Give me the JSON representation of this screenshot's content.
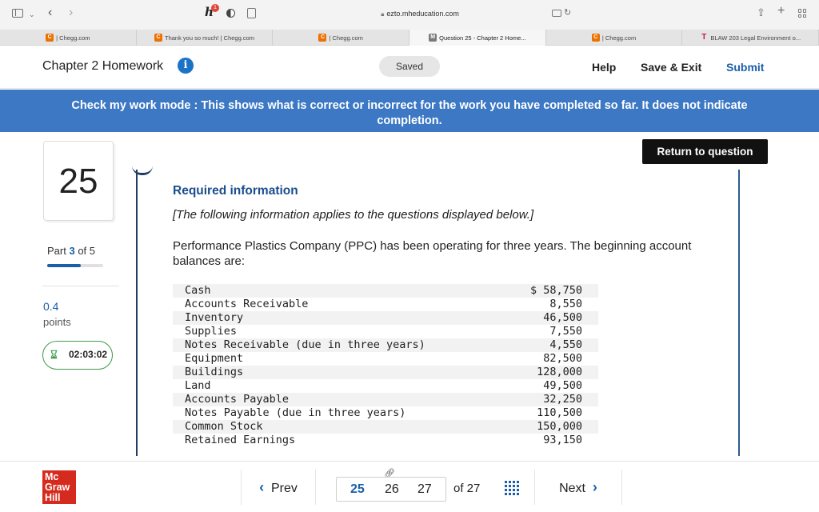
{
  "browser": {
    "url": "ezto.mheducation.com",
    "ext_badge": "1",
    "tabs": [
      {
        "label": "| Chegg.com",
        "favicon": "chegg",
        "active": false
      },
      {
        "label": "Thank you so much! | Chegg.com",
        "favicon": "chegg",
        "active": false
      },
      {
        "label": "| Chegg.com",
        "favicon": "chegg",
        "active": false
      },
      {
        "label": "Question 25 - Chapter 2 Home...",
        "favicon": "m",
        "active": true
      },
      {
        "label": "| Chegg.com",
        "favicon": "chegg",
        "active": false
      },
      {
        "label": "BLAW 203 Legal Environment o...",
        "favicon": "t",
        "active": false
      }
    ]
  },
  "header": {
    "title": "Chapter 2 Homework",
    "info_icon": "i",
    "saved": "Saved",
    "help": "Help",
    "save_exit": "Save & Exit",
    "submit": "Submit"
  },
  "banner": {
    "text": "Check my work mode : This shows what is correct or incorrect for the work you have completed so far. It does not indicate completion."
  },
  "sidebar": {
    "question_number": "25",
    "part_prefix": "Part",
    "part_current": "3",
    "part_suffix": "of 5",
    "part_progress": 0.6,
    "points_value": "0.4",
    "points_label": "points",
    "timer": "02:03:02"
  },
  "content": {
    "return_button": "Return to question",
    "required_heading": "Required information",
    "following_note": "[The following information applies to the questions displayed below.]",
    "paragraph": "Performance Plastics Company (PPC) has been operating for three years. The beginning account balances are:",
    "balances": [
      {
        "name": "Cash",
        "amount": "$ 58,750"
      },
      {
        "name": "Accounts Receivable",
        "amount": "8,550"
      },
      {
        "name": "Inventory",
        "amount": "46,500"
      },
      {
        "name": "Supplies",
        "amount": "7,550"
      },
      {
        "name": "Notes Receivable (due in three years)",
        "amount": "4,550"
      },
      {
        "name": "Equipment",
        "amount": "82,500"
      },
      {
        "name": "Buildings",
        "amount": "128,000"
      },
      {
        "name": "Land",
        "amount": "49,500"
      },
      {
        "name": "Accounts Payable",
        "amount": "32,250"
      },
      {
        "name": "Notes Payable (due in three years)",
        "amount": "110,500"
      },
      {
        "name": "Common Stock",
        "amount": "150,000"
      },
      {
        "name": "Retained Earnings",
        "amount": "93,150"
      }
    ]
  },
  "footer": {
    "logo": [
      "Mc",
      "Graw",
      "Hill"
    ],
    "prev": "Prev",
    "pages": [
      "25",
      "26",
      "27"
    ],
    "of_total": "of 27",
    "next": "Next"
  },
  "colors": {
    "banner": "#3c78c4",
    "accent_blue": "#1a5fa8",
    "timer_green": "#3c9a4a",
    "logo_red": "#d52b1e"
  }
}
